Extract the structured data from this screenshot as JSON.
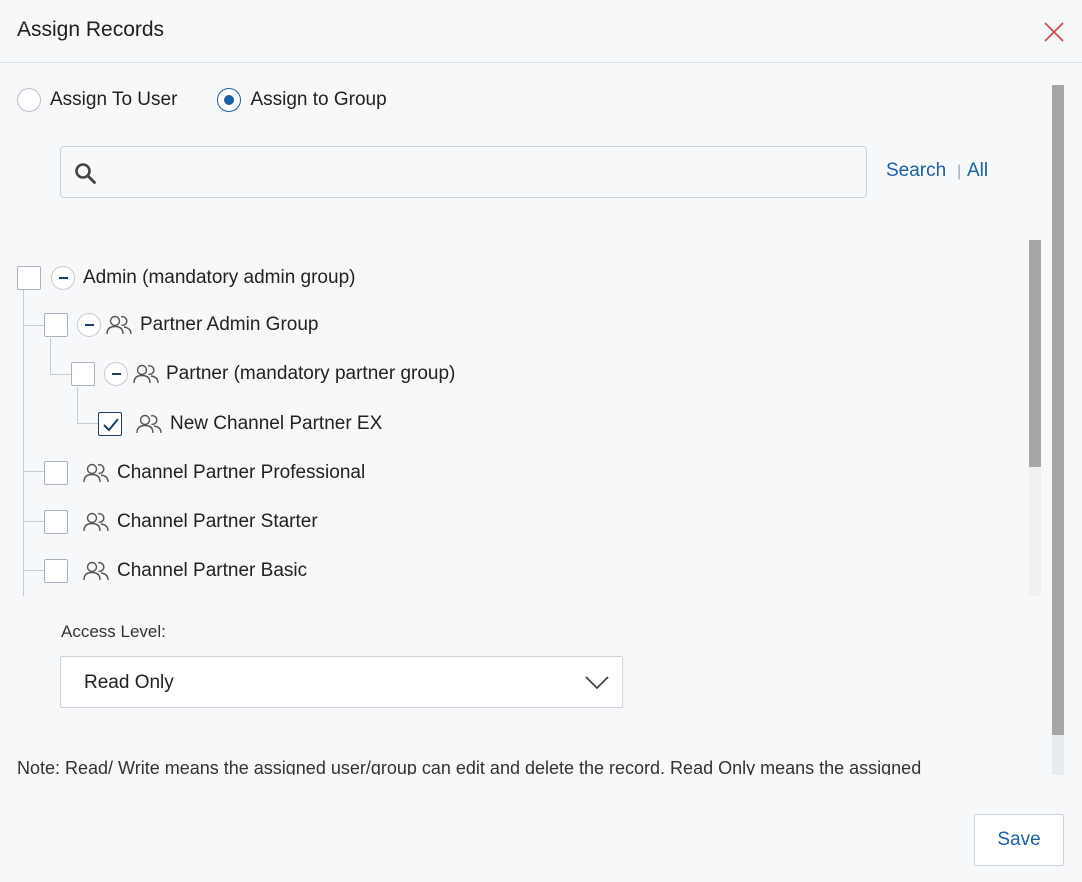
{
  "dialog": {
    "title": "Assign Records"
  },
  "assign_mode": {
    "options": [
      "Assign To User",
      "Assign to Group"
    ],
    "selected": "Assign to Group"
  },
  "search": {
    "value": "",
    "placeholder": "",
    "search_label": "Search",
    "all_label": "All"
  },
  "groups": [
    {
      "label": "Admin (mandatory admin group)",
      "level": 0,
      "checked": false,
      "expanded": true,
      "icon": "none"
    },
    {
      "label": "Partner Admin Group",
      "level": 1,
      "checked": false,
      "expanded": true,
      "icon": "users-icon"
    },
    {
      "label": "Partner (mandatory partner group)",
      "level": 2,
      "checked": false,
      "expanded": true,
      "icon": "users-icon"
    },
    {
      "label": "New Channel Partner EX",
      "level": 3,
      "checked": true,
      "expanded": null,
      "icon": "users-icon"
    },
    {
      "label": "Channel Partner Professional",
      "level": 1,
      "checked": false,
      "expanded": null,
      "icon": "users-icon"
    },
    {
      "label": "Channel Partner Starter",
      "level": 1,
      "checked": false,
      "expanded": null,
      "icon": "users-icon"
    },
    {
      "label": "Channel Partner Basic",
      "level": 1,
      "checked": false,
      "expanded": null,
      "icon": "users-icon"
    }
  ],
  "access": {
    "label": "Access Level:",
    "value": "Read Only"
  },
  "note": "Note: Read/ Write means the assigned user/group can edit and delete the record. Read Only means the assigned",
  "footer": {
    "save_label": "Save"
  },
  "colors": {
    "accent": "#1a5fa8",
    "close": "#d64545",
    "border": "#ccd2da",
    "background": "#f7f8fa"
  }
}
